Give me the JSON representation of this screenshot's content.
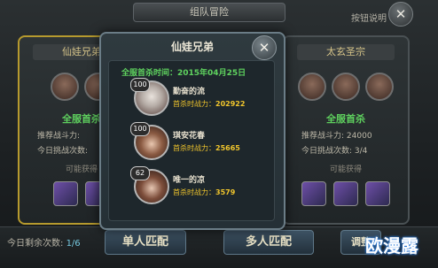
{
  "header": {
    "title": "组队冒险",
    "help": "按钮说明"
  },
  "left_panel": {
    "title": "仙娃兄弟",
    "first_kill_label": "全服首杀",
    "recommend": "推荐战斗力:",
    "today_challenge": "今日挑战次数:",
    "obtainable": "可能获得"
  },
  "right_panel": {
    "title": "太玄圣宗",
    "first_kill_label": "全服首杀",
    "recommend": "推荐战斗力:",
    "recommend_value": "24000",
    "today_challenge": "今日挑战次数:",
    "challenge_value": "3/4",
    "obtainable": "可能获得"
  },
  "modal": {
    "title": "仙娃兄弟",
    "first_kill_time": "全服首杀时间：2015年04月25日",
    "power_label": "首杀时战力：",
    "members": [
      {
        "level": "100",
        "name": "勤奋的流",
        "power": "202922"
      },
      {
        "level": "100",
        "name": "琪安花春",
        "power": "25665"
      },
      {
        "level": "62",
        "name": "唯一的凉",
        "power": "3579"
      }
    ]
  },
  "bottom": {
    "remaining_label": "今日剩余次数:",
    "remaining_value": "1/6",
    "single_match": "单人匹配",
    "multi_match": "多人匹配",
    "extra_button": "调整"
  },
  "watermark": "欧漫露"
}
